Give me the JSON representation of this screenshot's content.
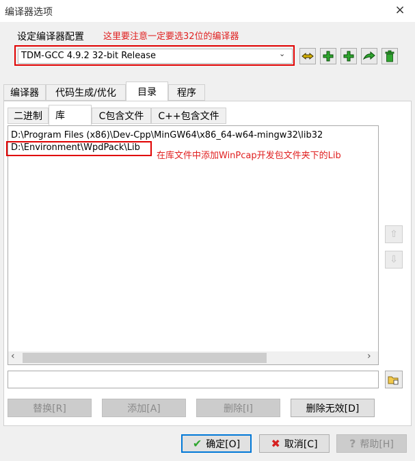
{
  "window": {
    "title": "编译器选项",
    "close_icon": "×"
  },
  "group": {
    "label": "设定编译器配置",
    "annotation": "这里要注意一定要选32位的编译器"
  },
  "compiler_select": {
    "value": "TDM-GCC 4.9.2 32-bit Release"
  },
  "main_tabs": [
    "编译器",
    "代码生成/优化",
    "目录",
    "程序"
  ],
  "sub_tabs": [
    "二进制",
    "库",
    "C包含文件",
    "C++包含文件"
  ],
  "dir_list": {
    "items": [
      "D:\\Program Files (x86)\\Dev-Cpp\\MinGW64\\x86_64-w64-mingw32\\lib32",
      "D:\\Environment\\WpdPack\\Lib"
    ],
    "annotation": "在库文件中添加WinPcap开发包文件夹下的Lib"
  },
  "path_input": {
    "value": ""
  },
  "actions": {
    "replace": "替换[R]",
    "add": "添加[A]",
    "delete": "删除[I]",
    "delete_invalid": "删除无效[D]"
  },
  "dialog_buttons": {
    "ok": "确定[O]",
    "cancel": "取消[C]",
    "help": "帮助[H]"
  },
  "colors": {
    "annotation": "#e02020",
    "highlight_box": "#e00000",
    "green_icon": "#2fa52f",
    "default_button": "#0078d7"
  }
}
